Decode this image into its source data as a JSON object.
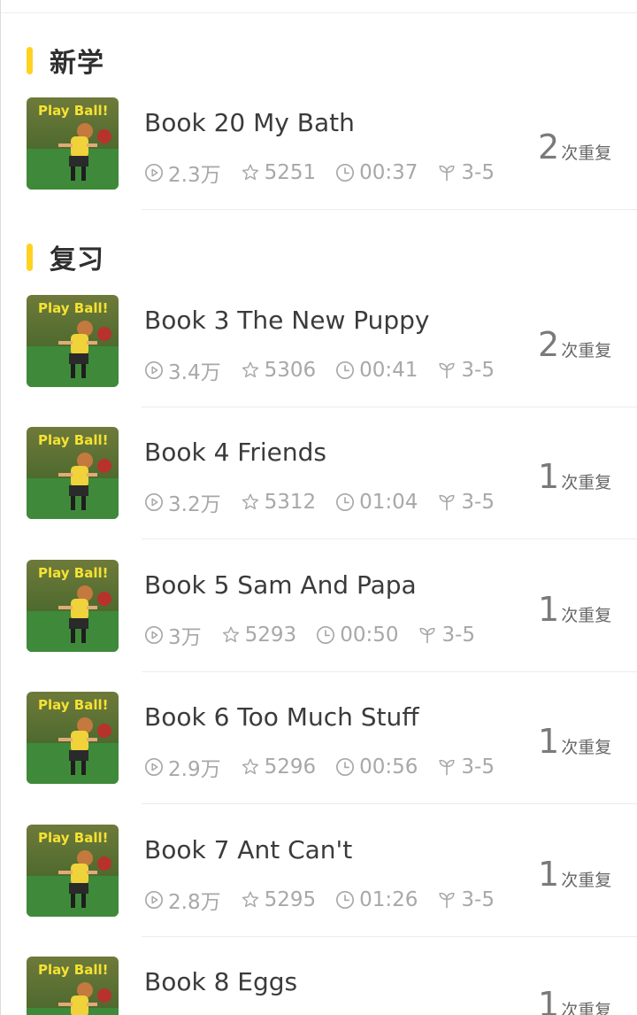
{
  "sections": {
    "new": {
      "title": "新学"
    },
    "review": {
      "title": "复习"
    }
  },
  "cover": {
    "title": "Play Ball!"
  },
  "colors": {
    "accent": "#ffd21f"
  },
  "icons": [
    "play-count-icon",
    "star-icon",
    "clock-icon",
    "sprout-icon"
  ],
  "books": [
    {
      "title": "Book 20 My Bath",
      "plays": "2.3万",
      "stars": "5251",
      "duration": "00:37",
      "age": "3-5",
      "repeat_count": "2",
      "repeat_label": "次重复"
    },
    {
      "title": "Book 3 The New Puppy",
      "plays": "3.4万",
      "stars": "5306",
      "duration": "00:41",
      "age": "3-5",
      "repeat_count": "2",
      "repeat_label": "次重复"
    },
    {
      "title": "Book 4 Friends",
      "plays": "3.2万",
      "stars": "5312",
      "duration": "01:04",
      "age": "3-5",
      "repeat_count": "1",
      "repeat_label": "次重复"
    },
    {
      "title": "Book 5 Sam And Papa",
      "plays": "3万",
      "stars": "5293",
      "duration": "00:50",
      "age": "3-5",
      "repeat_count": "1",
      "repeat_label": "次重复"
    },
    {
      "title": "Book 6 Too Much Stuff",
      "plays": "2.9万",
      "stars": "5296",
      "duration": "00:56",
      "age": "3-5",
      "repeat_count": "1",
      "repeat_label": "次重复"
    },
    {
      "title": "Book 7 Ant Can't",
      "plays": "2.8万",
      "stars": "5295",
      "duration": "01:26",
      "age": "3-5",
      "repeat_count": "1",
      "repeat_label": "次重复"
    },
    {
      "title": "Book 8 Eggs",
      "plays": "",
      "stars": "",
      "duration": "",
      "age": "",
      "repeat_count": "1",
      "repeat_label": "次重复"
    }
  ]
}
